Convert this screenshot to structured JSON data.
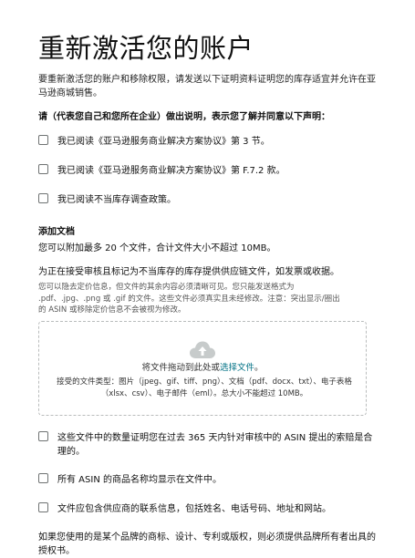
{
  "page": {
    "title": "重新激活您的账户",
    "intro": "要重新激活您的账户和移除权限，请发送以下证明资料证明您的库存适宜并允许在亚马逊商城销售。",
    "declaration_heading": "请（代表您自己和您所在企业）做出说明，表示您了解并同意以下声明："
  },
  "declarations": [
    "我已阅读《亚马逊服务商业解决方案协议》第 3 节。",
    "我已阅读《亚马逊服务商业解决方案协议》第 F.7.2 款。",
    "我已阅读不当库存调查政策。"
  ],
  "documents": {
    "section_title": "添加文档",
    "limit_text": "您可以附加最多 20 个文件，合计文件大小不超过 10MB。",
    "helper_text": "为正在接受审核且标记为不当库存的库存提供供应链文件，如发票或收据。",
    "small_print": "您可以隐去定价信息，但文件的其余内容必须清晰可见。您只能发送格式为 .pdf、.jpg、.png 或 .gif 的文件。这些文件必须真实且未经修改。注意：突出显示/圈出的 ASIN 或移除定价信息不会被视为修改。",
    "dropzone": {
      "icon": "cloud-upload-icon",
      "main_prefix": "将文件拖动到此处或",
      "main_link": "选择文件",
      "main_suffix": "。",
      "accepted_types": "接受的文件类型：图片（jpeg、gif、tiff、png）、文档（pdf、docx、txt）、电子表格（xlsx、csv）、电子邮件（eml）。总大小不能超过 10MB。"
    }
  },
  "confirmations": [
    "这些文件中的数量证明您在过去 365 天内针对审核中的 ASIN 提出的索赔是合理的。",
    "所有 ASIN 的商品名称均显示在文件中。",
    "文件应包含供应商的联系信息，包括姓名、电话号码、地址和网站。"
  ],
  "footer_note": "如果您使用的是某个品牌的商标、设计、专利或版权，则必须提供品牌所有者出具的授权书。",
  "colors": {
    "link": "#007185",
    "checkbox_border": "#6f7373",
    "dropzone_border": "#b9bcbc"
  }
}
